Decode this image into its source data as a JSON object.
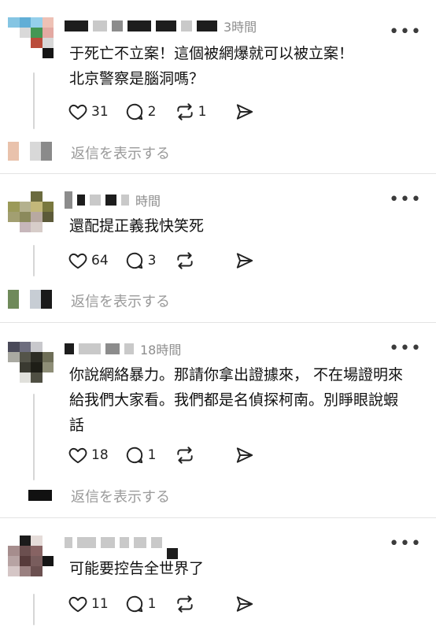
{
  "posts": [
    {
      "time": "3時間",
      "text_lines": [
        "于死亡不立案！這個被網爆就可以被立案！",
        "北京警察是腦洞嗎？"
      ],
      "likes": "31",
      "comments": "2",
      "reposts": "1",
      "replies_label": "返信を表示する"
    },
    {
      "time": "時間",
      "text_lines": [
        "還配提正義我快笑死"
      ],
      "likes": "64",
      "comments": "3",
      "reposts": "",
      "replies_label": "返信を表示する"
    },
    {
      "time": "18時間",
      "text_lines": [
        "你說網絡暴力。那請你拿出證據來，  不在場證明來",
        "給我們大家看。我們都是名偵探柯南。別睜眼說蝦",
        "話"
      ],
      "likes": "18",
      "comments": "1",
      "reposts": "",
      "replies_label": "返信を表示する"
    },
    {
      "time": "",
      "text_lines": [
        "可能要控告全世界了"
      ],
      "likes": "11",
      "comments": "1",
      "reposts": ""
    }
  ],
  "icons": {
    "more": "more-horizontal-icon",
    "like": "heart-icon",
    "comment": "comment-bubble-icon",
    "repost": "repost-arrows-icon",
    "share": "send-icon"
  },
  "colors": {
    "text": "#111111",
    "muted": "#8e8e8e",
    "divider": "#e3e3e3"
  }
}
